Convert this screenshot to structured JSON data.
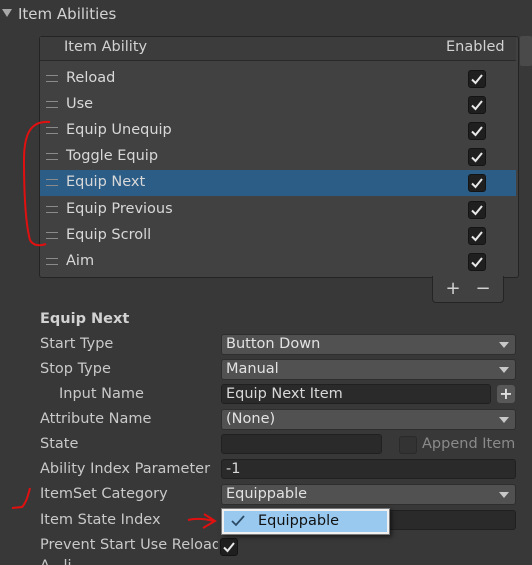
{
  "foldout": {
    "title": "Item Abilities"
  },
  "list": {
    "header_ability": "Item Ability",
    "header_enabled": "Enabled",
    "rows": [
      {
        "label": "Reload",
        "enabled": true
      },
      {
        "label": "Use",
        "enabled": true
      },
      {
        "label": "Equip Unequip",
        "enabled": true
      },
      {
        "label": "Toggle Equip",
        "enabled": true
      },
      {
        "label": "Equip Next",
        "enabled": true,
        "selected": true
      },
      {
        "label": "Equip Previous",
        "enabled": true
      },
      {
        "label": "Equip Scroll",
        "enabled": true
      },
      {
        "label": "Aim",
        "enabled": true
      }
    ],
    "add_label": "+",
    "remove_label": "−"
  },
  "detail": {
    "title": "Equip Next",
    "start_type_label": "Start Type",
    "start_type_value": "Button Down",
    "stop_type_label": "Stop Type",
    "stop_type_value": "Manual",
    "input_name_label": "Input Name",
    "input_name_value": "Equip Next Item",
    "attribute_name_label": "Attribute Name",
    "attribute_name_value": "(None)",
    "state_label": "State",
    "state_value": "",
    "append_item_label": "Append Item",
    "ability_index_label": "Ability Index Parameter",
    "ability_index_value": "-1",
    "itemset_category_label": "ItemSet Category",
    "itemset_category_value": "Equippable",
    "item_state_index_label": "Item State Index",
    "prevent_start_label": "Prevent Start Use Reload",
    "prevent_start_checked": true,
    "cut_label": "A...li..."
  },
  "popup": {
    "options": [
      {
        "label": "Equippable",
        "checked": true
      }
    ]
  },
  "colors": {
    "background": "#383838",
    "selected_row": "#2c5d87",
    "annotation_red": "#e01010",
    "popup_highlight": "#99c9ef"
  }
}
